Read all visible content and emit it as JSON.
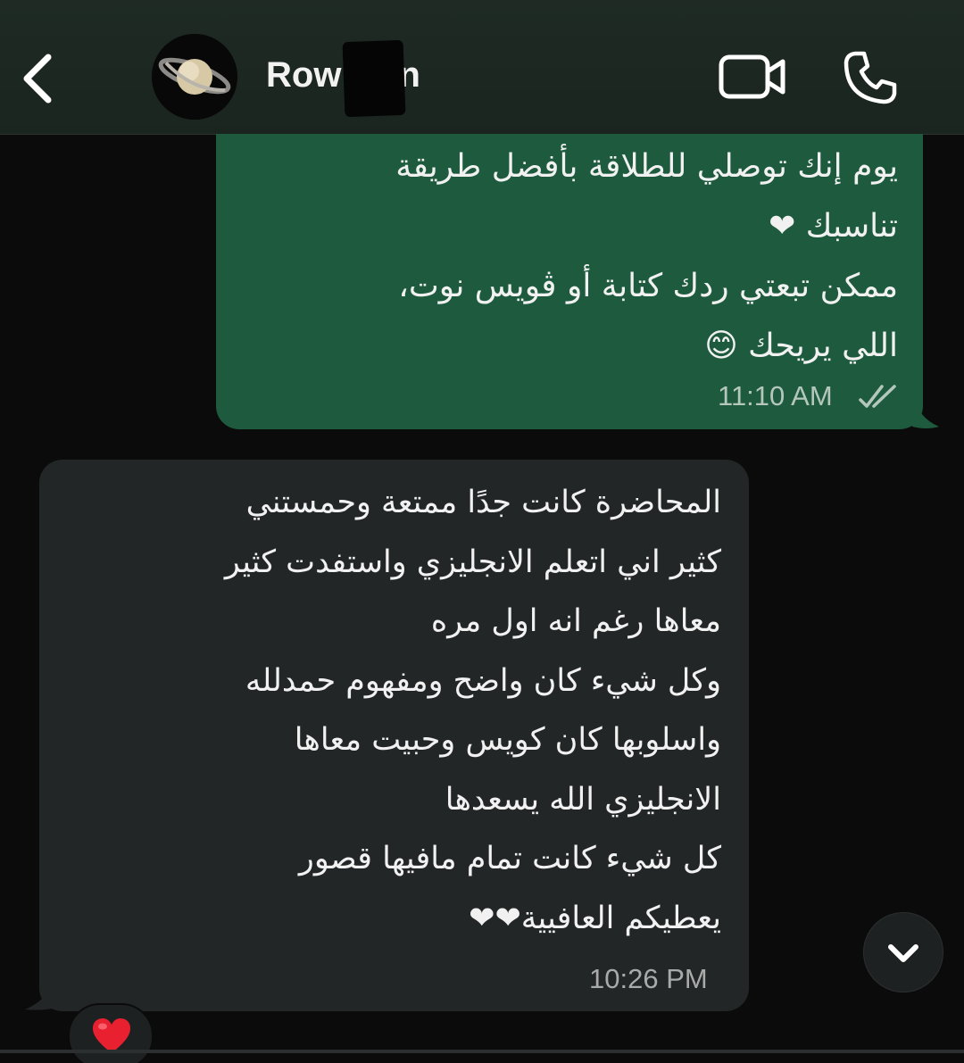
{
  "header": {
    "back_icon": "chevron-left-icon",
    "contact_name": "Row",
    "contact_name_suffix": "n",
    "video_icon": "video-call-icon",
    "call_icon": "phone-icon"
  },
  "messages": {
    "outgoing": {
      "text": "يوم إنك توصلي للطلاقة بأفضل طريقة\nتناسبك ❤\nممكن تبعتي ردك كتابة أو ڤويس نوت،\nاللي يريحك 😊",
      "time": "11:10 AM",
      "status_icon": "double-check-icon"
    },
    "incoming": {
      "text": "المحاضرة كانت جدًا ممتعة وحمستني\nكثير اني اتعلم الانجليزي واستفدت كثير\nمعاها رغم انه اول مره\nوكل شيء كان واضح ومفهوم حمدلله\nواسلوبها كان كويس وحبيت معاها\nالانجليزي الله يسعدها\nكل شيء كانت تمام مافيها قصور\nيعطيكم العافيية❤❤",
      "time": "10:26 PM",
      "reaction": "heart-emoji"
    }
  },
  "scroll_button_icon": "chevron-down-icon",
  "colors": {
    "outgoing_bubble": "#1e5b3e",
    "incoming_bubble": "#232626",
    "header": "#1f2a24",
    "background": "#0b0b0b"
  }
}
